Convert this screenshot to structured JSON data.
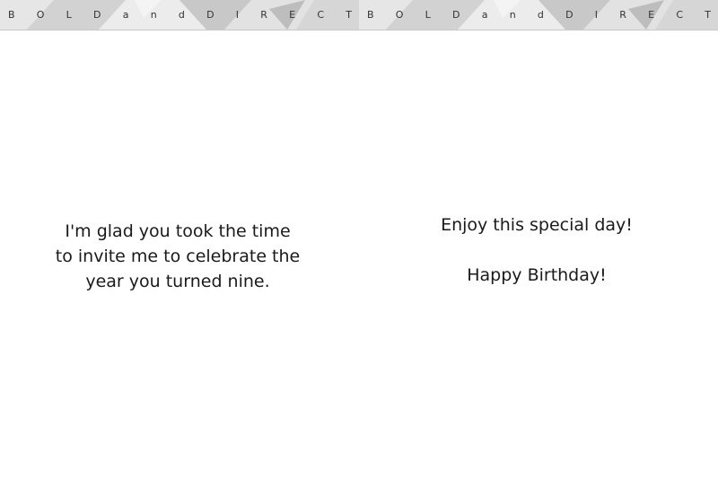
{
  "banner": {
    "letters": [
      "B",
      "O",
      "L",
      "D",
      "a",
      "n",
      "d",
      "D",
      "I",
      "R",
      "E",
      "C",
      "T"
    ],
    "background": "#dcdcdc",
    "facet_colors": [
      "#e8e8e8",
      "#cfcfcf",
      "#f0f0f0",
      "#c4c4c4"
    ]
  },
  "left_message": {
    "lines": [
      "I'm glad you took the time",
      "to invite me to celebrate the",
      "year you turned nine."
    ]
  },
  "right_message": {
    "line1": "Enjoy this special day!",
    "line2": "Happy Birthday!"
  }
}
